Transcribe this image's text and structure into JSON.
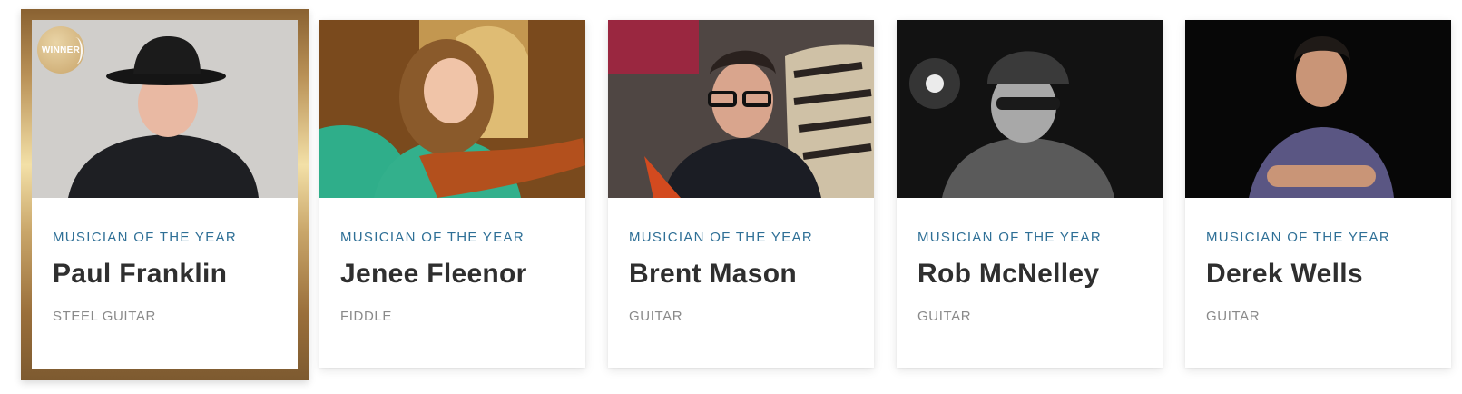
{
  "winner_badge": "WINNER",
  "nominees": [
    {
      "category": "MUSICIAN OF THE YEAR",
      "name": "Paul Franklin",
      "instrument": "STEEL GUITAR",
      "photo_alt": "Paul Franklin photo",
      "winner": true
    },
    {
      "category": "MUSICIAN OF THE YEAR",
      "name": "Jenee Fleenor",
      "instrument": "FIDDLE",
      "photo_alt": "Jenee Fleenor photo",
      "winner": false
    },
    {
      "category": "MUSICIAN OF THE YEAR",
      "name": "Brent Mason",
      "instrument": "GUITAR",
      "photo_alt": "Brent Mason photo",
      "winner": false
    },
    {
      "category": "MUSICIAN OF THE YEAR",
      "name": "Rob McNelley",
      "instrument": "GUITAR",
      "photo_alt": "Rob McNelley photo",
      "winner": false
    },
    {
      "category": "MUSICIAN OF THE YEAR",
      "name": "Derek Wells",
      "instrument": "GUITAR",
      "photo_alt": "Derek Wells photo",
      "winner": false
    }
  ]
}
